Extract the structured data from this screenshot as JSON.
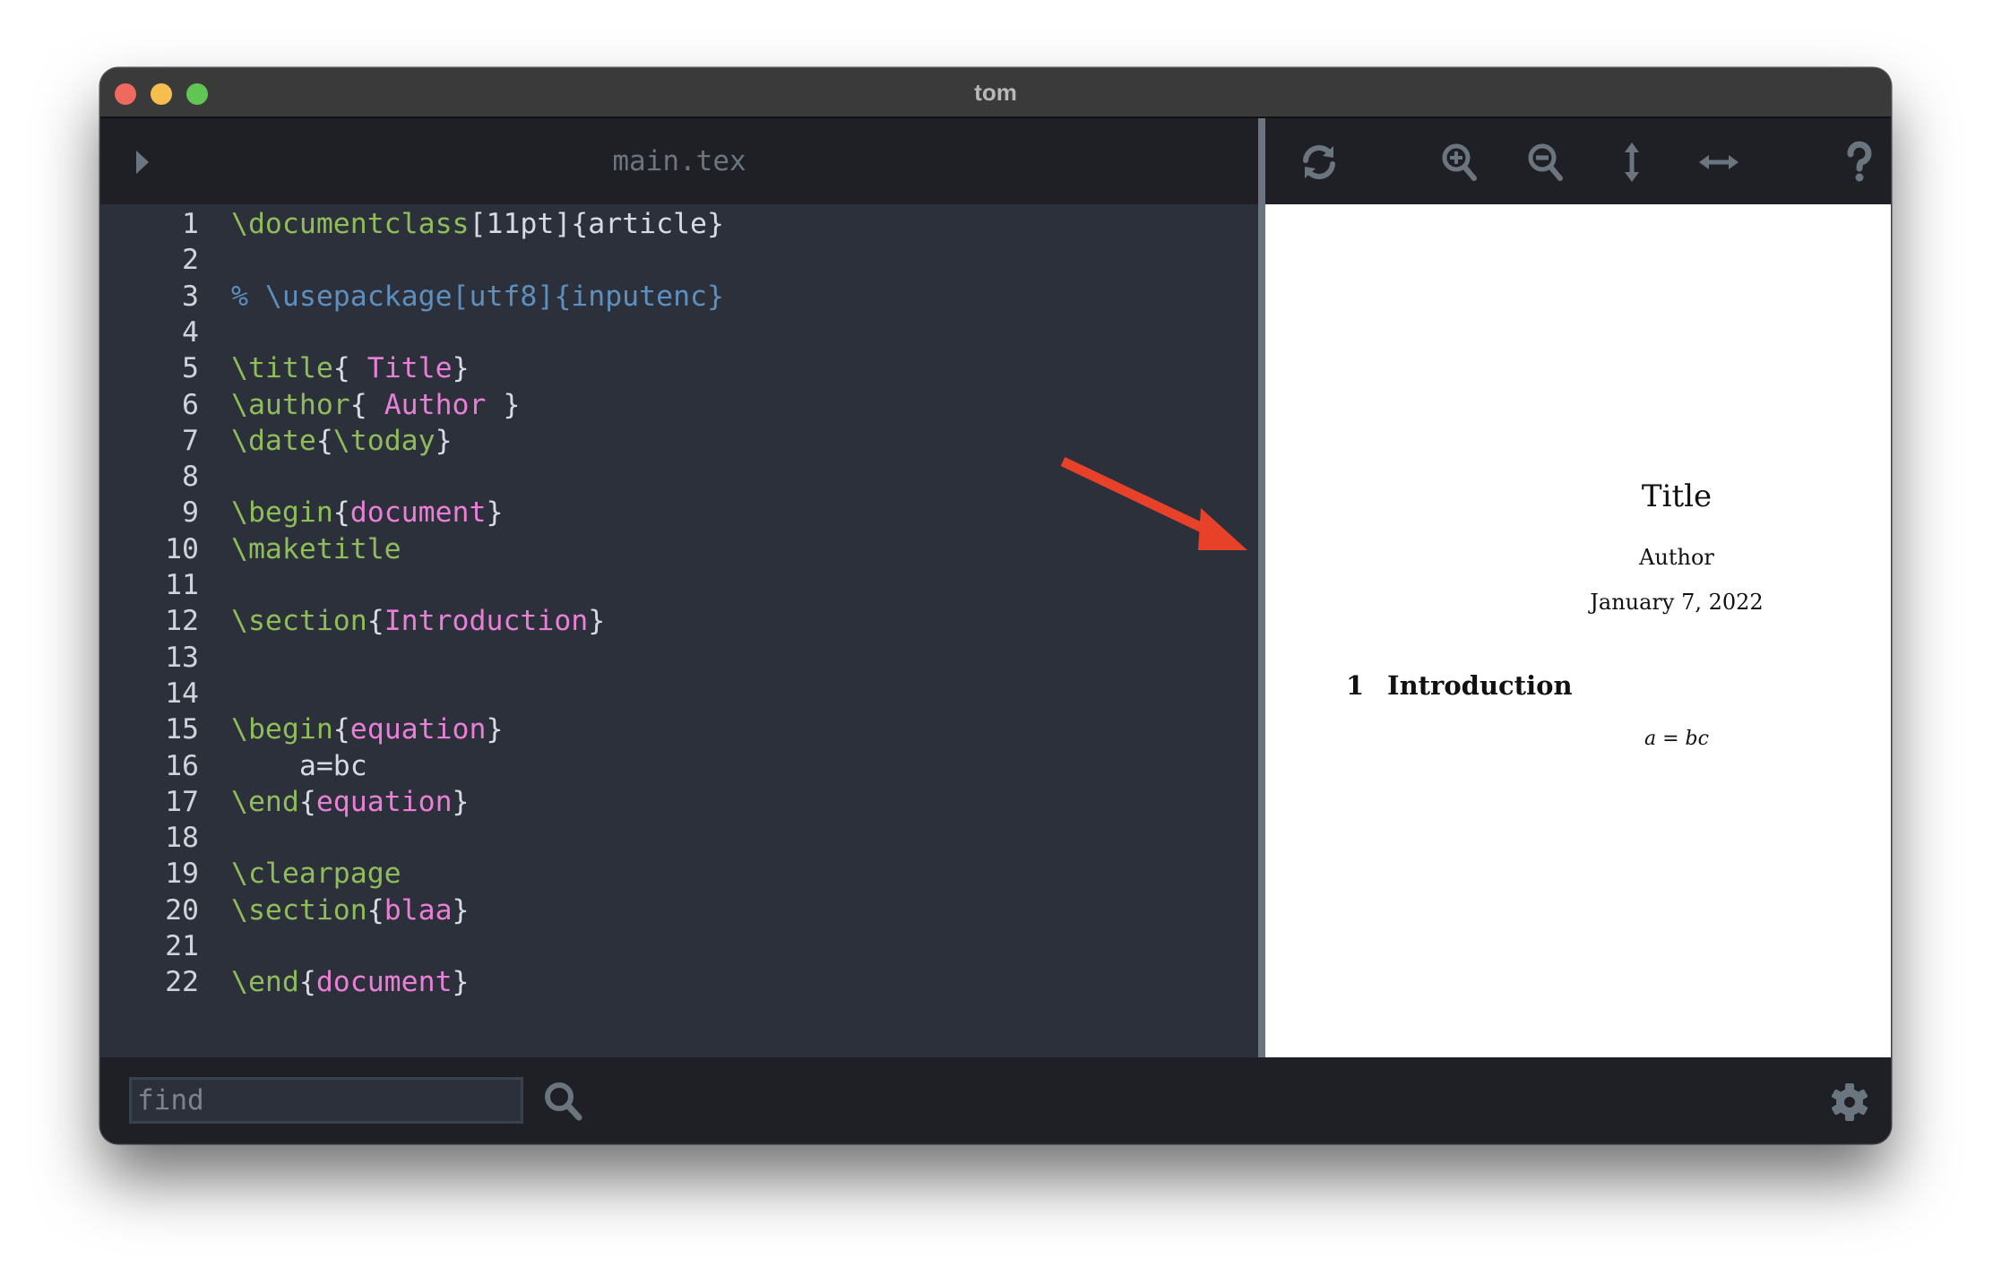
{
  "window": {
    "title": "tom"
  },
  "editor": {
    "file_name": "main.tex",
    "lines": [
      {
        "n": "1",
        "tokens": [
          {
            "t": "\\documentclass",
            "k": "cmd"
          },
          {
            "t": "[11pt]{article}",
            "k": "plain"
          }
        ]
      },
      {
        "n": "2",
        "tokens": []
      },
      {
        "n": "3",
        "tokens": [
          {
            "t": "% \\usepackage[utf8]{inputenc}",
            "k": "comment"
          }
        ]
      },
      {
        "n": "4",
        "tokens": []
      },
      {
        "n": "5",
        "tokens": [
          {
            "t": "\\title",
            "k": "cmd"
          },
          {
            "t": "{ ",
            "k": "plain"
          },
          {
            "t": "Title",
            "k": "arg"
          },
          {
            "t": "}",
            "k": "plain"
          }
        ]
      },
      {
        "n": "6",
        "tokens": [
          {
            "t": "\\author",
            "k": "cmd"
          },
          {
            "t": "{ ",
            "k": "plain"
          },
          {
            "t": "Author",
            "k": "arg"
          },
          {
            "t": " }",
            "k": "plain"
          }
        ]
      },
      {
        "n": "7",
        "tokens": [
          {
            "t": "\\date",
            "k": "cmd"
          },
          {
            "t": "{",
            "k": "plain"
          },
          {
            "t": "\\today",
            "k": "cmd"
          },
          {
            "t": "}",
            "k": "plain"
          }
        ]
      },
      {
        "n": "8",
        "tokens": []
      },
      {
        "n": "9",
        "tokens": [
          {
            "t": "\\begin",
            "k": "cmd"
          },
          {
            "t": "{",
            "k": "plain"
          },
          {
            "t": "document",
            "k": "arg"
          },
          {
            "t": "}",
            "k": "plain"
          }
        ]
      },
      {
        "n": "10",
        "tokens": [
          {
            "t": "\\maketitle",
            "k": "cmd"
          }
        ]
      },
      {
        "n": "11",
        "tokens": []
      },
      {
        "n": "12",
        "tokens": [
          {
            "t": "\\section",
            "k": "cmd"
          },
          {
            "t": "{",
            "k": "plain"
          },
          {
            "t": "Introduction",
            "k": "arg"
          },
          {
            "t": "}",
            "k": "plain"
          }
        ]
      },
      {
        "n": "13",
        "tokens": []
      },
      {
        "n": "14",
        "tokens": []
      },
      {
        "n": "15",
        "tokens": [
          {
            "t": "\\begin",
            "k": "cmd"
          },
          {
            "t": "{",
            "k": "plain"
          },
          {
            "t": "equation",
            "k": "arg"
          },
          {
            "t": "}",
            "k": "plain"
          }
        ]
      },
      {
        "n": "16",
        "tokens": [
          {
            "t": "    a=bc",
            "k": "plain"
          }
        ]
      },
      {
        "n": "17",
        "tokens": [
          {
            "t": "\\end",
            "k": "cmd"
          },
          {
            "t": "{",
            "k": "plain"
          },
          {
            "t": "equation",
            "k": "arg"
          },
          {
            "t": "}",
            "k": "plain"
          }
        ]
      },
      {
        "n": "18",
        "tokens": []
      },
      {
        "n": "19",
        "tokens": [
          {
            "t": "\\clearpage",
            "k": "cmd"
          }
        ]
      },
      {
        "n": "20",
        "tokens": [
          {
            "t": "\\section",
            "k": "cmd"
          },
          {
            "t": "{",
            "k": "plain"
          },
          {
            "t": "blaa",
            "k": "arg"
          },
          {
            "t": "}",
            "k": "plain"
          }
        ]
      },
      {
        "n": "21",
        "tokens": []
      },
      {
        "n": "22",
        "tokens": [
          {
            "t": "\\end",
            "k": "cmd"
          },
          {
            "t": "{",
            "k": "plain"
          },
          {
            "t": "document",
            "k": "arg"
          },
          {
            "t": "}",
            "k": "plain"
          }
        ]
      }
    ],
    "colors": {
      "command": "#8ebd5a",
      "argument": "#e97fd7",
      "comment": "#5d8fbf",
      "plain": "#d7dae0"
    }
  },
  "pdf_toolbar": {
    "icons": [
      "refresh-icon",
      "zoom-in-icon",
      "zoom-out-icon",
      "fit-height-icon",
      "fit-width-icon",
      "help-icon"
    ]
  },
  "pdf": {
    "title": "Title",
    "author": "Author",
    "date": "January 7, 2022",
    "section_number": "1",
    "section_title": "Introduction",
    "equation": "a = bc"
  },
  "bottom_bar": {
    "find_placeholder": "find",
    "find_value": ""
  },
  "annotation": {
    "arrow_color": "#e8412a"
  }
}
